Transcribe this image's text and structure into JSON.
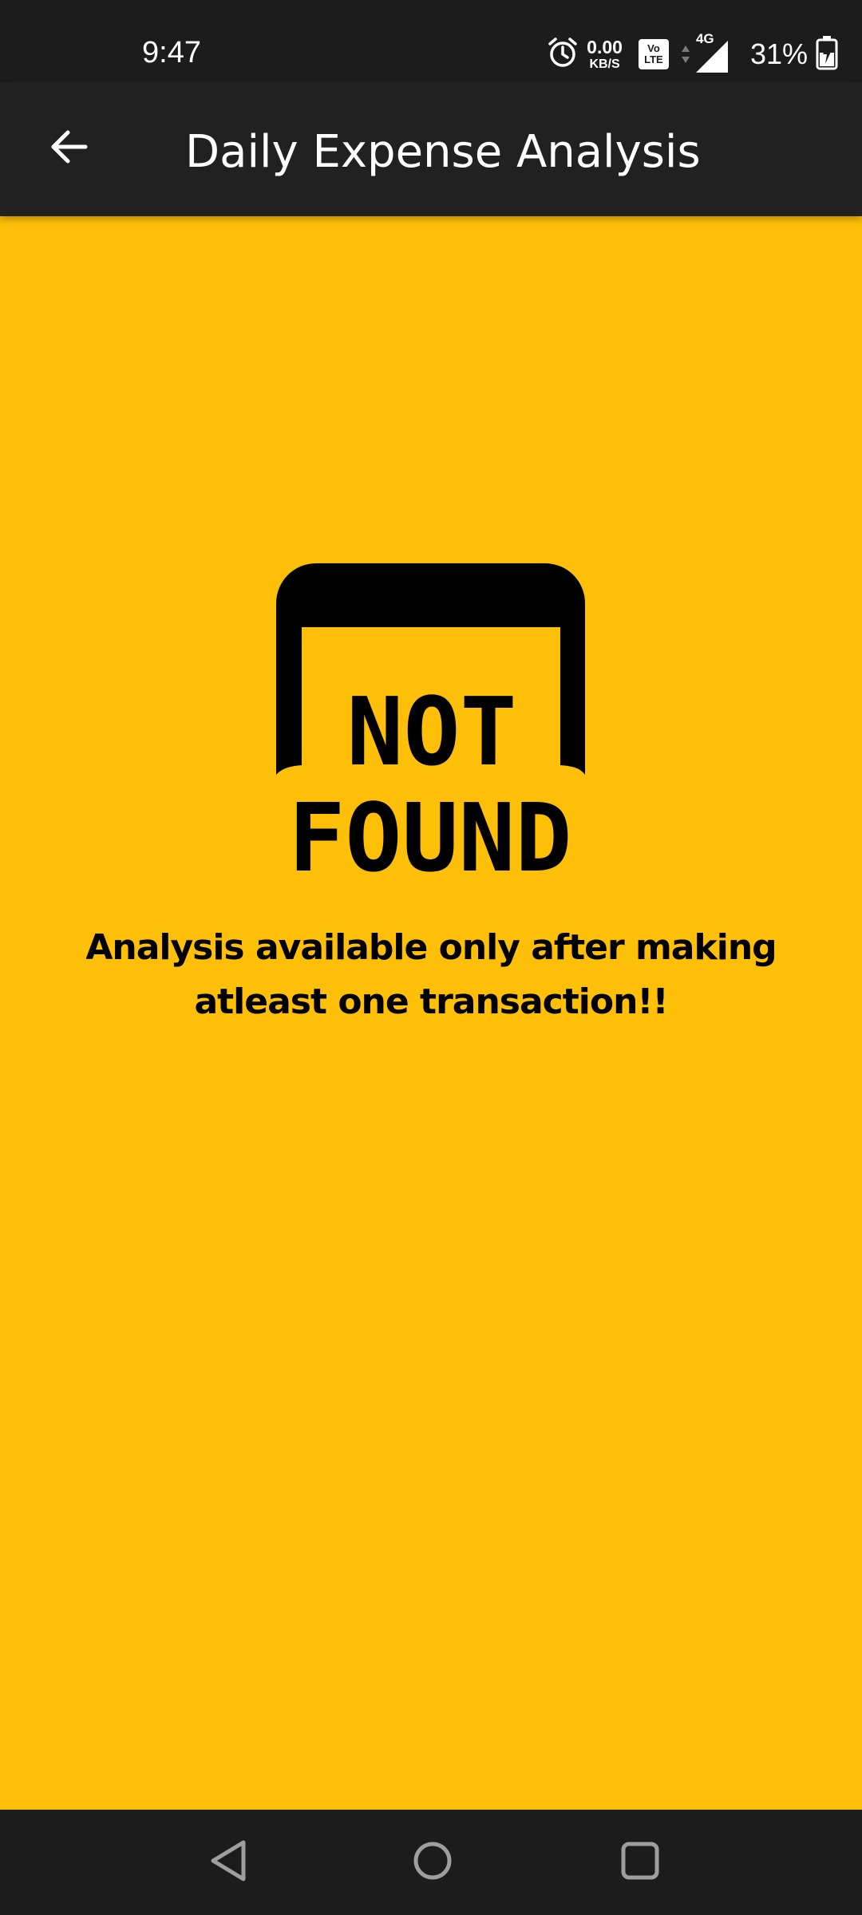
{
  "status_bar": {
    "time": "9:47",
    "net_speed_value": "0.00",
    "net_speed_unit": "KB/S",
    "volte_top": "Vo",
    "volte_bottom": "LTE",
    "network_type": "4G",
    "battery": "31%",
    "icons": [
      "alarm-icon",
      "volte-icon",
      "signal-icon",
      "battery-charging-icon"
    ]
  },
  "app_bar": {
    "title": "Daily Expense Analysis",
    "back_icon": "arrow-back-icon"
  },
  "empty_state": {
    "graphic_line1": "NOT",
    "graphic_line2": "FOUND",
    "message": "Analysis available only after making atleast one transaction!!"
  },
  "nav_bar": {
    "icons": [
      "nav-back-icon",
      "nav-home-icon",
      "nav-recents-icon"
    ]
  },
  "colors": {
    "background": "#FDBF07",
    "app_bar": "#212121",
    "status_bar": "#1C1C1D",
    "text_dark": "#000000",
    "text_light": "#FFFFFF"
  }
}
